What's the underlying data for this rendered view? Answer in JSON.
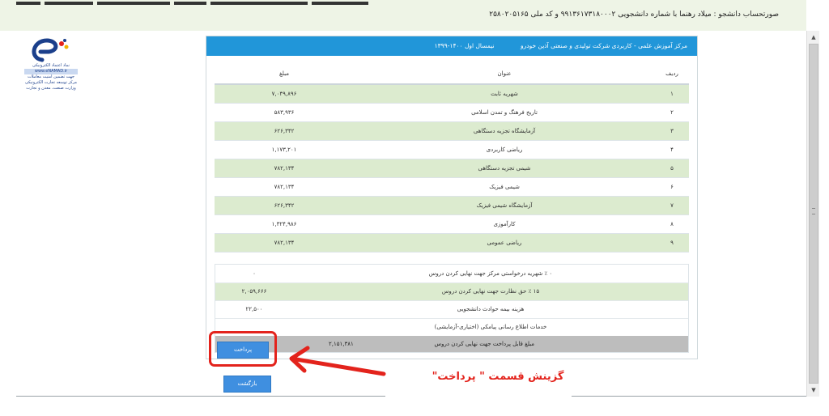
{
  "header": {
    "student_info": "صورتحساب دانشجو : میلاد رهنما با شماره دانشجویی ۹۹۱۳۶۱۷۳۱۸۰۰۰۲ و کد ملی ۲۵۸۰۲۰۵۱۶۵"
  },
  "logo": {
    "icon": "enamad-logo",
    "lines": [
      "نماد اعتماد الکترونیکی",
      "www.eNAMAD.ir",
      "جهت تضمین امنیت معاملات",
      "مرکز توسعه تجارت الکترونیکی",
      "وزارت صنعت، معدن و تجارت"
    ]
  },
  "panel": {
    "title": "مرکز آموزش علمی - کاربردی شرکت تولیدی و صنعتی آذین خودرو",
    "term": "نیمسال اول ۱۴۰۰-۱۳۹۹"
  },
  "courses": {
    "headers": {
      "row": "ردیف",
      "title": "عنوان",
      "amount": "مبلغ"
    },
    "rows": [
      {
        "row": "۱",
        "title": "شهریه ثابت",
        "amount": "۷,۰۴۹,۸۹۶"
      },
      {
        "row": "۲",
        "title": "تاریخ فرهنگ و تمدن اسلامی",
        "amount": "۵۸۳,۹۳۶"
      },
      {
        "row": "۳",
        "title": "آزمایشگاه تجزیه دستگاهی",
        "amount": "۶۲۶,۳۴۲"
      },
      {
        "row": "۴",
        "title": "ریاضی کاربردی",
        "amount": "۱,۱۷۳,۲۰۱"
      },
      {
        "row": "۵",
        "title": "شیمی تجزیه دستگاهی",
        "amount": "۷۸۲,۱۳۴"
      },
      {
        "row": "۶",
        "title": "شیمی فیزیک",
        "amount": "۷۸۲,۱۳۴"
      },
      {
        "row": "۷",
        "title": "آزمایشگاه شیمی فیزیک",
        "amount": "۶۲۶,۳۴۲"
      },
      {
        "row": "۸",
        "title": "کارآموزی",
        "amount": "۱,۳۲۴,۹۸۶"
      },
      {
        "row": "۹",
        "title": "ریاضی عمومی",
        "amount": "۷۸۲,۱۳۴"
      }
    ]
  },
  "totals": {
    "rows": [
      {
        "label": "۰ ٪ شهریه درخواستی مرکز جهت نهایی کردن دروس",
        "amount": "۰"
      },
      {
        "label": "۱۵ ٪ حق نظارت جهت نهایی کردن دروس",
        "amount": "۲,۰۵۹,۶۶۶"
      },
      {
        "label": "هزینه بیمه حوادث دانشجویی",
        "amount": "۲۲,۵۰۰"
      },
      {
        "label": "خدمات اطلاع رسانی پیامکی (اختیاری-آزمایشی)",
        "amount": ""
      }
    ],
    "final_label": "مبلغ قابل پرداخت جهت نهایی کردن دروس",
    "final_amount": "۲,۱۵۱,۳۸۱"
  },
  "buttons": {
    "pay": "پرداخت",
    "back": "بازگشت"
  },
  "annotation": {
    "text": "گزینش قسمت \" پرداخت\"",
    "color": "#e3231c"
  },
  "colors": {
    "header_blue": "#2196d9",
    "row_green": "#dcebcf",
    "button_blue": "#3f8fe0"
  }
}
